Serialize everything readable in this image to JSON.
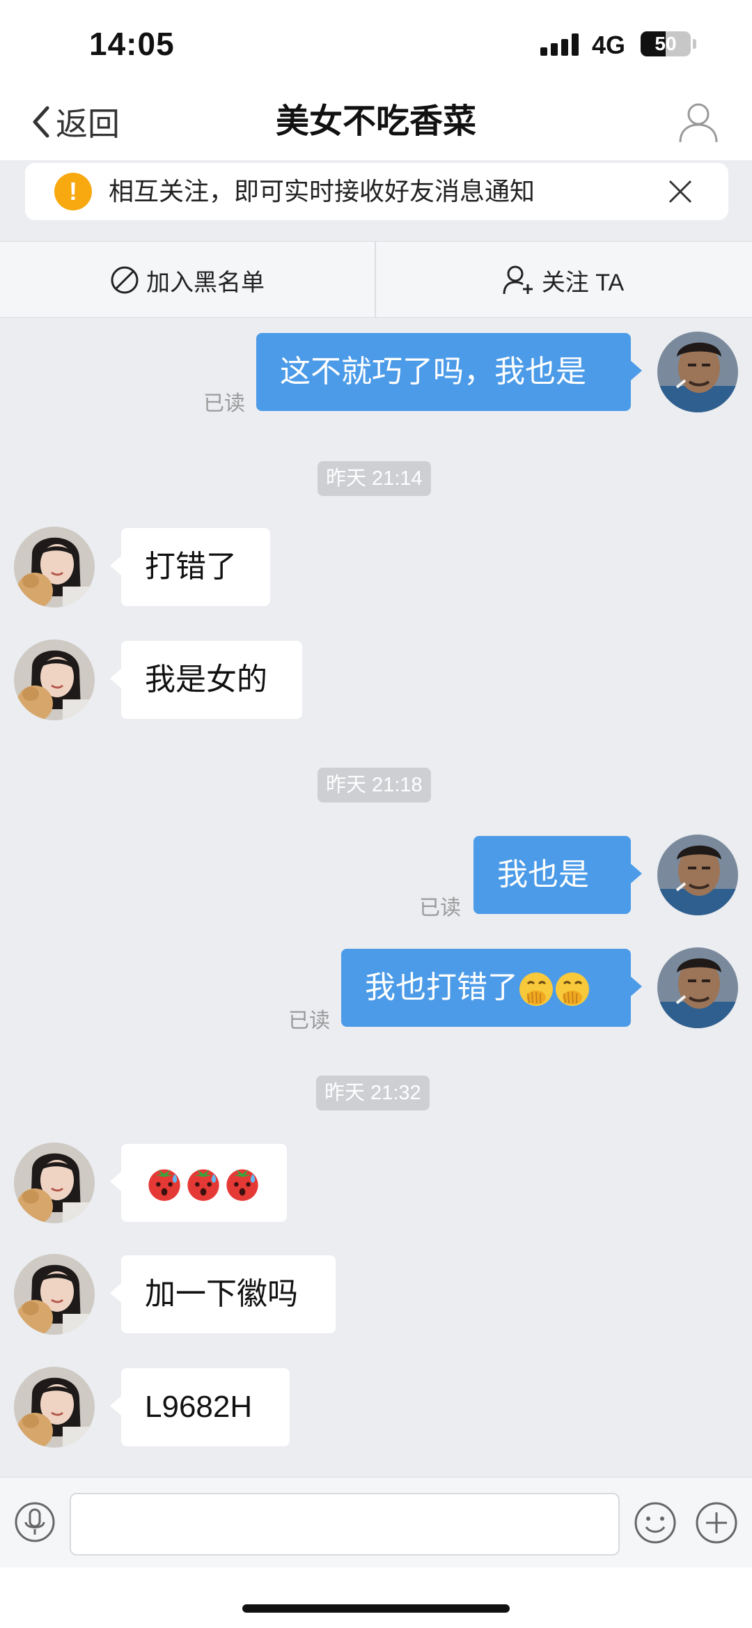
{
  "status": {
    "time": "14:05",
    "network": "4G",
    "battery": "50",
    "battery_level_percent": 50
  },
  "nav": {
    "back_label": "返回",
    "title": "美女不吃香菜",
    "back_icon": "chevron-left-icon",
    "profile_icon": "person-icon"
  },
  "banner": {
    "icon": "exclamation-icon",
    "text": "相互关注，即可实时接收好友消息通知",
    "close_icon": "close-icon"
  },
  "actions": {
    "blacklist_label": "加入黑名单",
    "follow_label": "关注 TA"
  },
  "chat": {
    "m1": {
      "text": "这不就巧了吗，我也是",
      "status": "已读",
      "sender": "me"
    },
    "t1": "昨天 21:14",
    "m2": {
      "text": "打错了",
      "sender": "other"
    },
    "m3": {
      "text": "我是女的",
      "sender": "other"
    },
    "t2": "昨天 21:18",
    "m4": {
      "text": "我也是",
      "status": "已读",
      "sender": "me"
    },
    "m5": {
      "text": "我也打错了",
      "emoji": "face-with-hand-over-mouth",
      "emoji_count": 2,
      "status": "已读",
      "sender": "me"
    },
    "t3": "昨天 21:32",
    "m6": {
      "emoji": "sweating-tomato",
      "emoji_count": 3,
      "sender": "other"
    },
    "m7": {
      "text": "加一下徽吗",
      "sender": "other"
    },
    "m8": {
      "text": "L9682H",
      "sender": "other"
    }
  },
  "inputbar": {
    "input_value": "",
    "mic_icon": "microphone-icon",
    "emoji_icon": "smiley-icon",
    "plus_icon": "plus-icon"
  },
  "colors": {
    "outgoing_bubble": "#4c9be8",
    "incoming_bubble": "#ffffff",
    "background": "#ebedf1",
    "warning": "#f7a90f"
  }
}
